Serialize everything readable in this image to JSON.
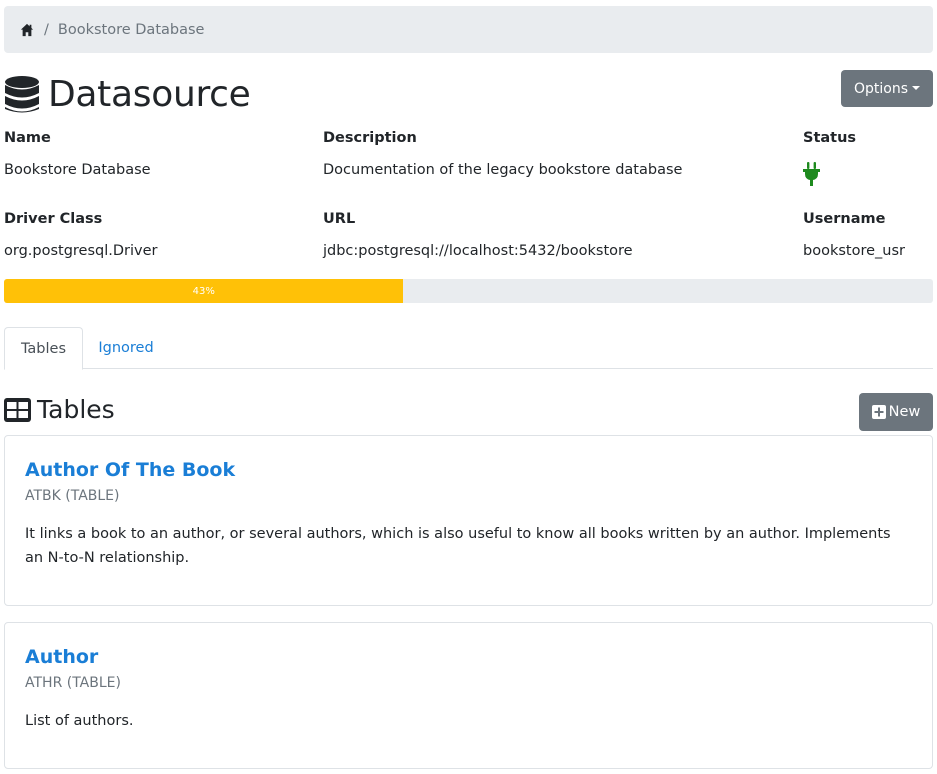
{
  "breadcrumb": {
    "home_icon": "home-icon",
    "separator": "/",
    "current": "Bookstore Database"
  },
  "header": {
    "title": "Datasource",
    "icon": "database-icon",
    "options_label": "Options"
  },
  "fields": {
    "name_label": "Name",
    "name_value": "Bookstore Database",
    "description_label": "Description",
    "description_value": "Documentation of the legacy bookstore database",
    "status_label": "Status",
    "status_icon": "plug-icon",
    "status_color": "#1e8a1e",
    "driver_label": "Driver Class",
    "driver_value": "org.postgresql.Driver",
    "url_label": "URL",
    "url_value": "jdbc:postgresql://localhost:5432/bookstore",
    "username_label": "Username",
    "username_value": "bookstore_usr"
  },
  "progress": {
    "percent": 43,
    "label": "43%",
    "color": "#ffc107"
  },
  "tabs": [
    {
      "label": "Tables",
      "active": true
    },
    {
      "label": "Ignored",
      "active": false
    }
  ],
  "section": {
    "title": "Tables",
    "icon": "table-icon",
    "new_label": "New",
    "new_icon": "plus-square-icon"
  },
  "cards": [
    {
      "title": "Author Of The Book",
      "subtitle": "ATBK (TABLE)",
      "description": "It links a book to an author, or several authors, which is also useful to know all books written by an author. Implements an N-to-N relationship."
    },
    {
      "title": "Author",
      "subtitle": "ATHR (TABLE)",
      "description": "List of authors."
    }
  ],
  "colors": {
    "link": "#1a7ed6",
    "button": "#6c757d",
    "breadcrumb_bg": "#e9ecef"
  }
}
